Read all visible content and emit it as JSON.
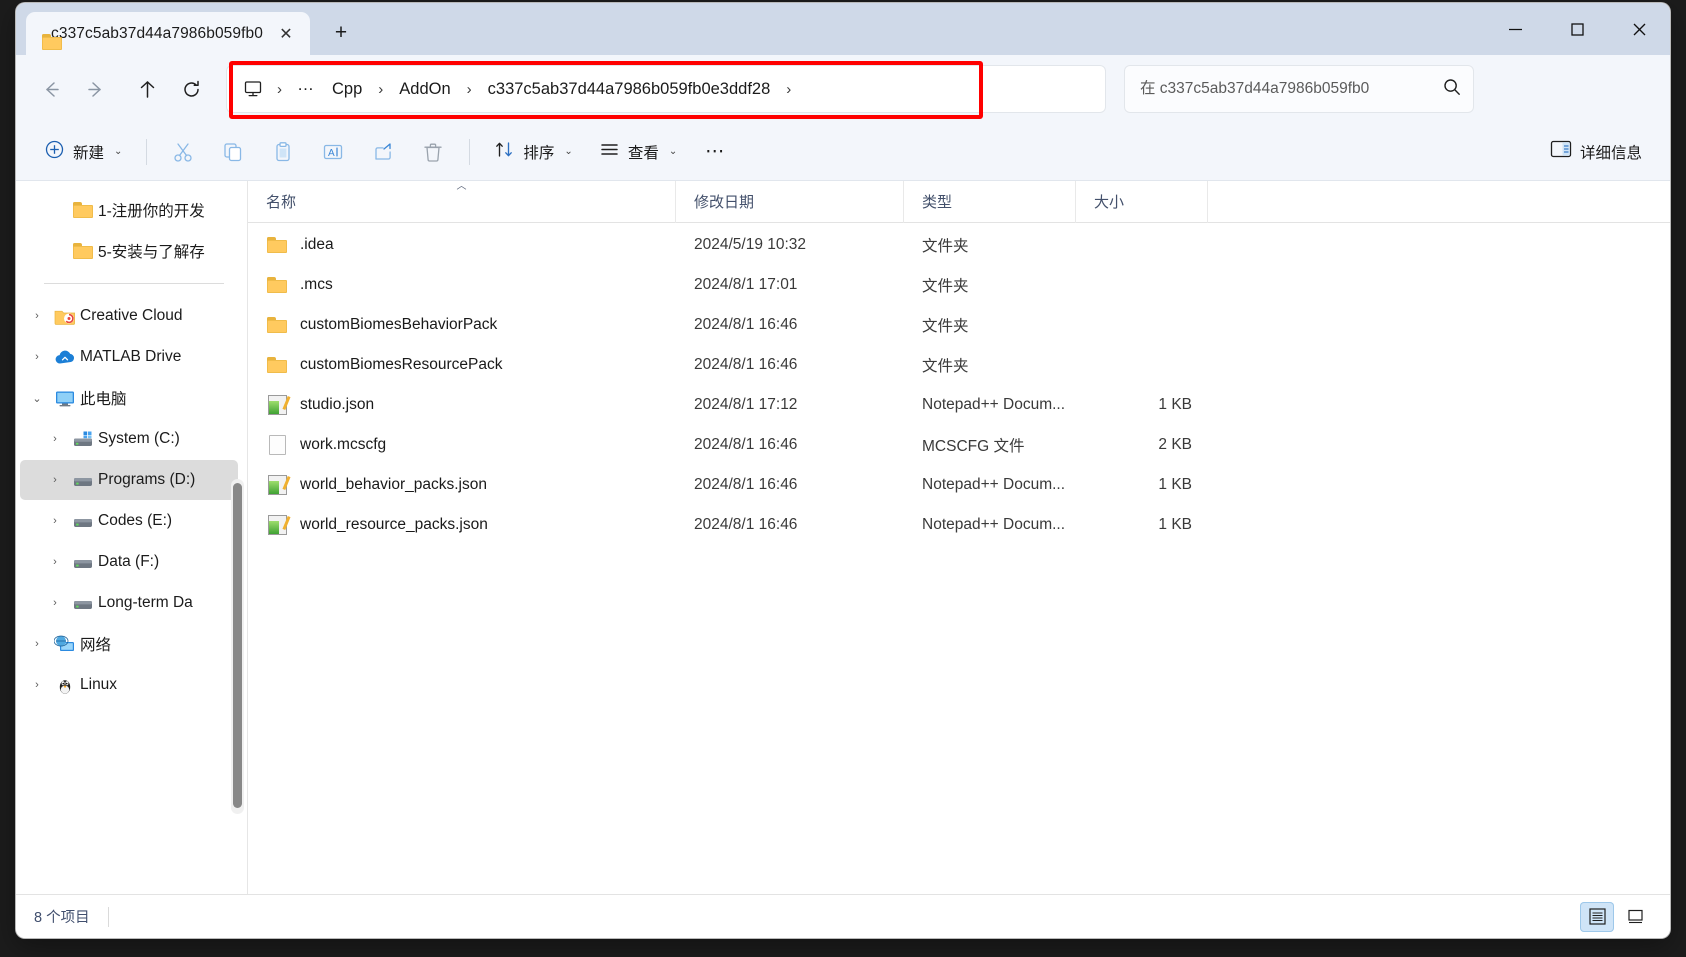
{
  "window": {
    "tab_title": "c337c5ab37d44a7986b059fb0",
    "tab_close_label": "✕",
    "new_tab_label": "+",
    "minimize_label": "—",
    "maximize_label": "▢",
    "close_label": "✕"
  },
  "nav": {
    "back_label": "←",
    "forward_label": "→",
    "up_label": "↑",
    "refresh_label": "⟳",
    "highlight_color": "#ff0000"
  },
  "address": {
    "root_icon": "this-pc-icon",
    "crumbs": [
      {
        "label": "…",
        "type": "ellipsis"
      },
      {
        "label": "Cpp",
        "type": "crumb"
      },
      {
        "label": "AddOn",
        "type": "crumb"
      },
      {
        "label": "c337c5ab37d44a7986b059fb0e3ddf28",
        "type": "crumb"
      }
    ],
    "separator": "›",
    "trailing_separator": "›"
  },
  "search": {
    "placeholder": "在 c337c5ab37d44a7986b059fb0",
    "value": "",
    "icon": "search-icon"
  },
  "toolbar": {
    "new_label": "新建",
    "cut_label": "剪切",
    "copy_label": "复制",
    "paste_label": "粘贴",
    "rename_label": "重命名",
    "share_label": "共享",
    "delete_label": "删除",
    "sort_label": "排序",
    "view_label": "查看",
    "more_label": "⋯",
    "details_label": "详细信息",
    "chevron": "⌄"
  },
  "sidebar": {
    "items": [
      {
        "label": "1-注册你的开发",
        "icon": "folder-icon",
        "twisty": "",
        "indent": 1,
        "selected": false
      },
      {
        "label": "5-安装与了解存",
        "icon": "folder-icon",
        "twisty": "",
        "indent": 1,
        "selected": false
      },
      {
        "label": "Creative Cloud",
        "icon": "creative-cloud-icon",
        "twisty": "›",
        "indent": 0,
        "selected": false
      },
      {
        "label": "MATLAB Drive",
        "icon": "matlab-drive-icon",
        "twisty": "›",
        "indent": 0,
        "selected": false
      },
      {
        "label": "此电脑",
        "icon": "this-pc-icon",
        "twisty": "⌄",
        "indent": 0,
        "selected": false
      },
      {
        "label": "System (C:)",
        "icon": "system-drive-icon",
        "twisty": "›",
        "indent": 1,
        "selected": false
      },
      {
        "label": "Programs (D:)",
        "icon": "drive-icon",
        "twisty": "›",
        "indent": 1,
        "selected": true
      },
      {
        "label": "Codes (E:)",
        "icon": "drive-icon",
        "twisty": "›",
        "indent": 1,
        "selected": false
      },
      {
        "label": "Data (F:)",
        "icon": "drive-icon",
        "twisty": "›",
        "indent": 1,
        "selected": false
      },
      {
        "label": "Long-term Da",
        "icon": "drive-icon",
        "twisty": "›",
        "indent": 1,
        "selected": false
      },
      {
        "label": "网络",
        "icon": "network-icon",
        "twisty": "›",
        "indent": 0,
        "selected": false
      },
      {
        "label": "Linux",
        "icon": "linux-icon",
        "twisty": "›",
        "indent": 0,
        "selected": false
      }
    ]
  },
  "columns": {
    "name": "名称",
    "date": "修改日期",
    "type": "类型",
    "size": "大小",
    "sort_caret": "︿",
    "sort_column": "名称",
    "sort_direction": "ascending"
  },
  "files": [
    {
      "name": ".idea",
      "date": "2024/5/19 10:32",
      "type": "文件夹",
      "size": "",
      "icon": "folder-icon"
    },
    {
      "name": ".mcs",
      "date": "2024/8/1 17:01",
      "type": "文件夹",
      "size": "",
      "icon": "folder-icon"
    },
    {
      "name": "customBiomesBehaviorPack",
      "date": "2024/8/1 16:46",
      "type": "文件夹",
      "size": "",
      "icon": "folder-icon"
    },
    {
      "name": "customBiomesResourcePack",
      "date": "2024/8/1 16:46",
      "type": "文件夹",
      "size": "",
      "icon": "folder-icon"
    },
    {
      "name": "studio.json",
      "date": "2024/8/1 17:12",
      "type": "Notepad++ Docum...",
      "size": "1 KB",
      "icon": "notepadpp-icon"
    },
    {
      "name": "work.mcscfg",
      "date": "2024/8/1 16:46",
      "type": "MCSCFG 文件",
      "size": "2 KB",
      "icon": "generic-file-icon"
    },
    {
      "name": "world_behavior_packs.json",
      "date": "2024/8/1 16:46",
      "type": "Notepad++ Docum...",
      "size": "1 KB",
      "icon": "notepadpp-icon"
    },
    {
      "name": "world_resource_packs.json",
      "date": "2024/8/1 16:46",
      "type": "Notepad++ Docum...",
      "size": "1 KB",
      "icon": "notepadpp-icon"
    }
  ],
  "status": {
    "item_count": "8 个项目",
    "view_details_icon": "details-view-icon",
    "view_tiles_icon": "large-icons-view-icon"
  }
}
